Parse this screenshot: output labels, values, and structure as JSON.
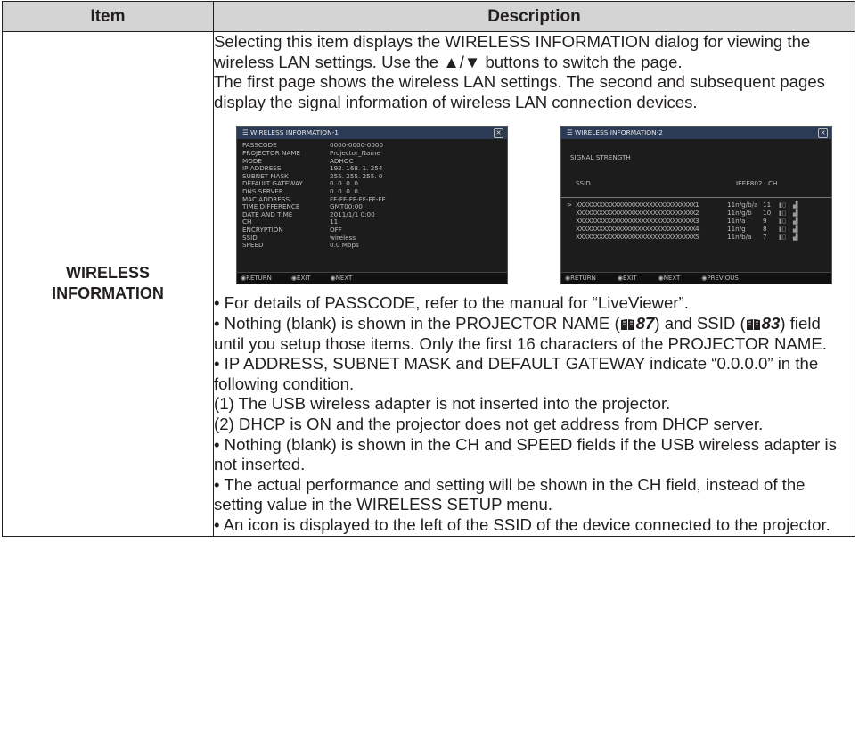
{
  "table": {
    "header_item": "Item",
    "header_description": "Description",
    "item_line1": "WIRELESS",
    "item_line2": "INFORMATION"
  },
  "intro": [
    "Selecting this item displays the WIRELESS INFORMATION dialog for viewing the wireless LAN settings. Use the ▲/▼ buttons to switch the page.",
    "The first page shows the wireless LAN settings. The second and subsequent pages display the signal information of wireless LAN connection devices."
  ],
  "screen1": {
    "title": "WIRELESS INFORMATION-1",
    "close": "✕",
    "rows": [
      {
        "k": "PASSCODE",
        "v": "0000-0000-0000"
      },
      {
        "k": "PROJECTOR NAME",
        "v": "Projector_Name"
      },
      {
        "k": "MODE",
        "v": "ADHOC"
      },
      {
        "k": "IP ADDRESS",
        "v": "192. 168. 1. 254"
      },
      {
        "k": "SUBNET MASK",
        "v": "255. 255. 255. 0"
      },
      {
        "k": "DEFAULT GATEWAY",
        "v": "0. 0. 0. 0"
      },
      {
        "k": "DNS SERVER",
        "v": "0. 0. 0. 0"
      },
      {
        "k": "MAC ADDRESS",
        "v": "FF-FF-FF-FF-FF-FF"
      },
      {
        "k": "TIME DIFFERENCE",
        "v": "GMT00:00"
      },
      {
        "k": "DATE AND TIME",
        "v": "2011/1/1 0:00"
      },
      {
        "k": "CH",
        "v": "11"
      },
      {
        "k": "ENCRYPTION",
        "v": "OFF"
      },
      {
        "k": "SSID",
        "v": "wireless"
      },
      {
        "k": "SPEED",
        "v": "0.0 Mbps"
      }
    ],
    "footer": [
      "RETURN",
      "EXIT",
      "NEXT"
    ]
  },
  "screen2": {
    "title": "WIRELESS INFORMATION-2",
    "close": "✕",
    "signal_label": "SIGNAL STRENGTH",
    "col_ssid": "SSID",
    "col_ieee": "IEEE802.",
    "col_ch": "CH",
    "rows": [
      {
        "mark": "⊳",
        "ssid": "XXXXXXXXXXXXXXXXXXXXXXXXXXXXXXX1",
        "ieee": "11n/g/b/a",
        "ch": "11"
      },
      {
        "mark": "",
        "ssid": "XXXXXXXXXXXXXXXXXXXXXXXXXXXXXXX2",
        "ieee": "11n/g/b",
        "ch": "10"
      },
      {
        "mark": "",
        "ssid": "XXXXXXXXXXXXXXXXXXXXXXXXXXXXXXX3",
        "ieee": "11n/a",
        "ch": "9"
      },
      {
        "mark": "",
        "ssid": "XXXXXXXXXXXXXXXXXXXXXXXXXXXXXXX4",
        "ieee": "11n/g",
        "ch": "8"
      },
      {
        "mark": "",
        "ssid": "XXXXXXXXXXXXXXXXXXXXXXXXXXXXXXX5",
        "ieee": "11n/b/a",
        "ch": "7"
      }
    ],
    "footer": [
      "RETURN",
      "EXIT",
      "NEXT",
      "PREVIOUS"
    ]
  },
  "notes": {
    "n1": "• For details of PASSCODE, refer to the manual for “LiveViewer”.",
    "n2_a": "• Nothing (blank) is shown in the PROJECTOR NAME (",
    "n2_p1": "87",
    "n2_b": ") and SSID (",
    "n2_p2": "83",
    "n2_c": ") field until you setup those items. Only the first 16 characters of the PROJECTOR NAME.",
    "n3": "• IP ADDRESS, SUBNET MASK and DEFAULT GATEWAY indicate “0.0.0.0” in the following condition.",
    "n4": "(1) The USB wireless adapter is not inserted into the projector.",
    "n5": "(2) DHCP is ON and the projector does not get address from DHCP server.",
    "n6": "• Nothing (blank) is shown in the CH and SPEED fields if the USB wireless adapter is not inserted.",
    "n7": "• The actual performance and setting will be shown in the CH field, instead of the setting value in the WIRELESS SETUP menu.",
    "n8": "• An icon is displayed to the left of the SSID of the device connected to the projector."
  }
}
